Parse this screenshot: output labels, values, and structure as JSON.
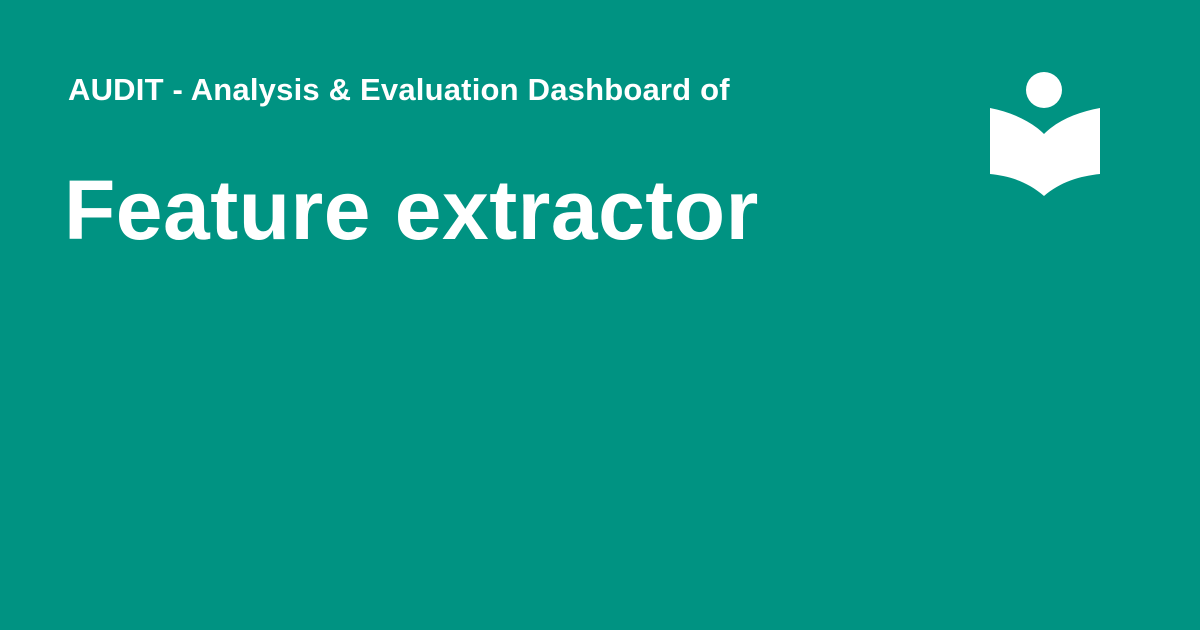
{
  "card": {
    "background_color": "#009382",
    "text_color": "#ffffff",
    "subtitle": "AUDIT - Analysis & Evaluation Dashboard of",
    "title": "Feature extractor",
    "logo_icon": "reader-book-icon"
  }
}
